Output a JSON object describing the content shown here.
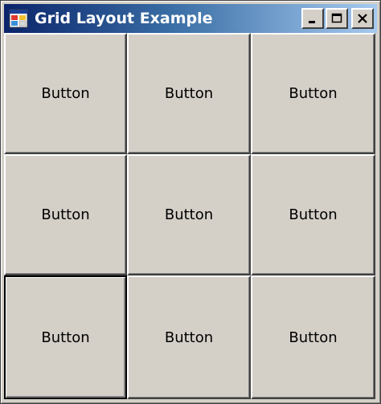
{
  "window": {
    "title": "Grid Layout Example"
  },
  "caption_buttons": {
    "minimize_icon": "minimize-icon",
    "maximize_icon": "maximize-icon",
    "close_icon": "close-icon"
  },
  "grid": {
    "rows": 3,
    "cols": 3,
    "buttons": [
      {
        "label": "Button"
      },
      {
        "label": "Button"
      },
      {
        "label": "Button"
      },
      {
        "label": "Button"
      },
      {
        "label": "Button"
      },
      {
        "label": "Button"
      },
      {
        "label": "Button"
      },
      {
        "label": "Button"
      },
      {
        "label": "Button"
      }
    ],
    "focused_index": 6
  },
  "colors": {
    "face": "#d4d0c8",
    "title_start": "#0a246a",
    "title_end": "#a6caf0",
    "title_text": "#ffffff"
  }
}
